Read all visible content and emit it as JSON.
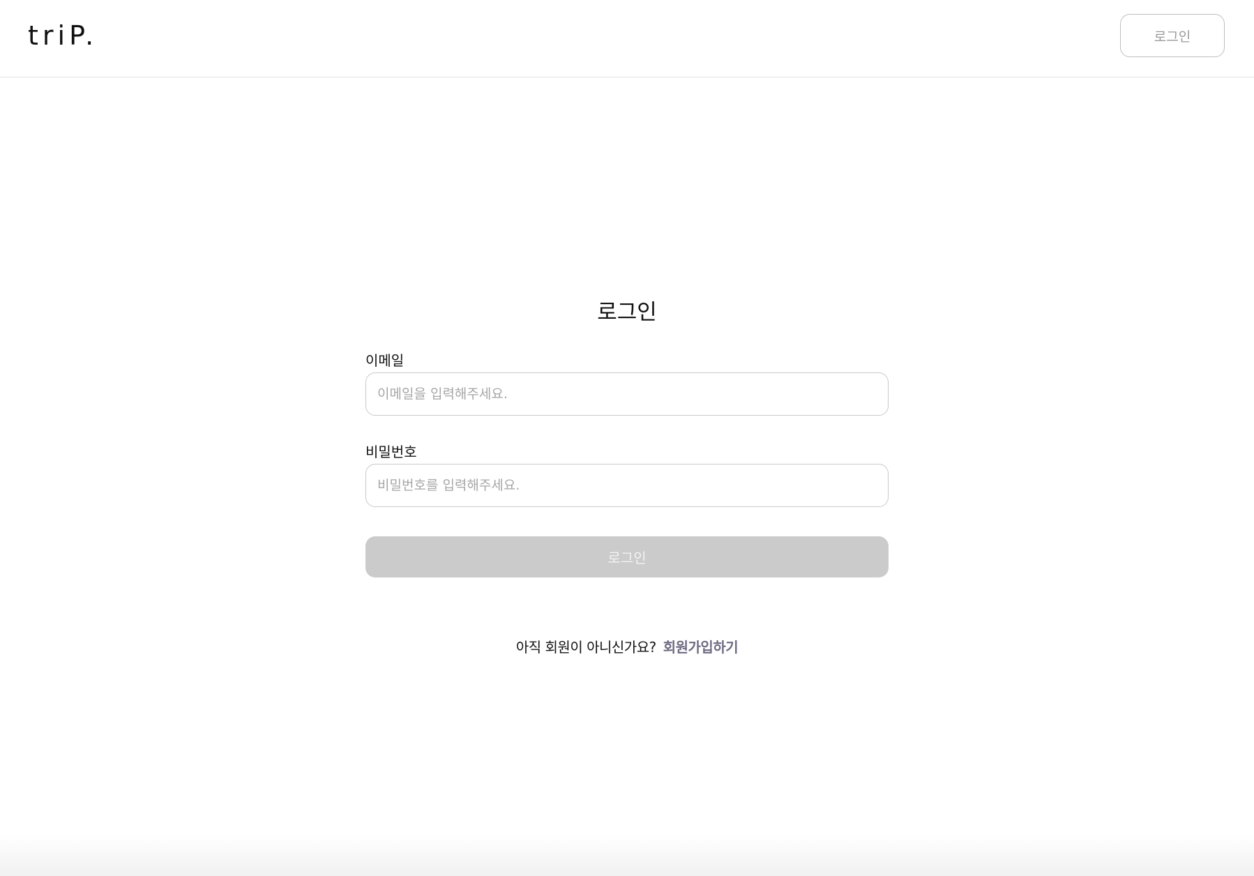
{
  "header": {
    "logo_text": "triP.",
    "login_button_label": "로그인"
  },
  "login_form": {
    "title": "로그인",
    "email": {
      "label": "이메일",
      "placeholder": "이메일을 입력해주세요.",
      "value": ""
    },
    "password": {
      "label": "비밀번호",
      "placeholder": "비밀번호를 입력해주세요.",
      "value": ""
    },
    "submit_label": "로그인",
    "submit_enabled": false
  },
  "signup_prompt": {
    "question": "아직 회원이 아니신가요?",
    "link_label": "회원가입하기"
  },
  "colors": {
    "submit_disabled_bg": "#cbcbcb",
    "signup_link": "#6e6a82",
    "input_border": "#c9c9c9"
  }
}
